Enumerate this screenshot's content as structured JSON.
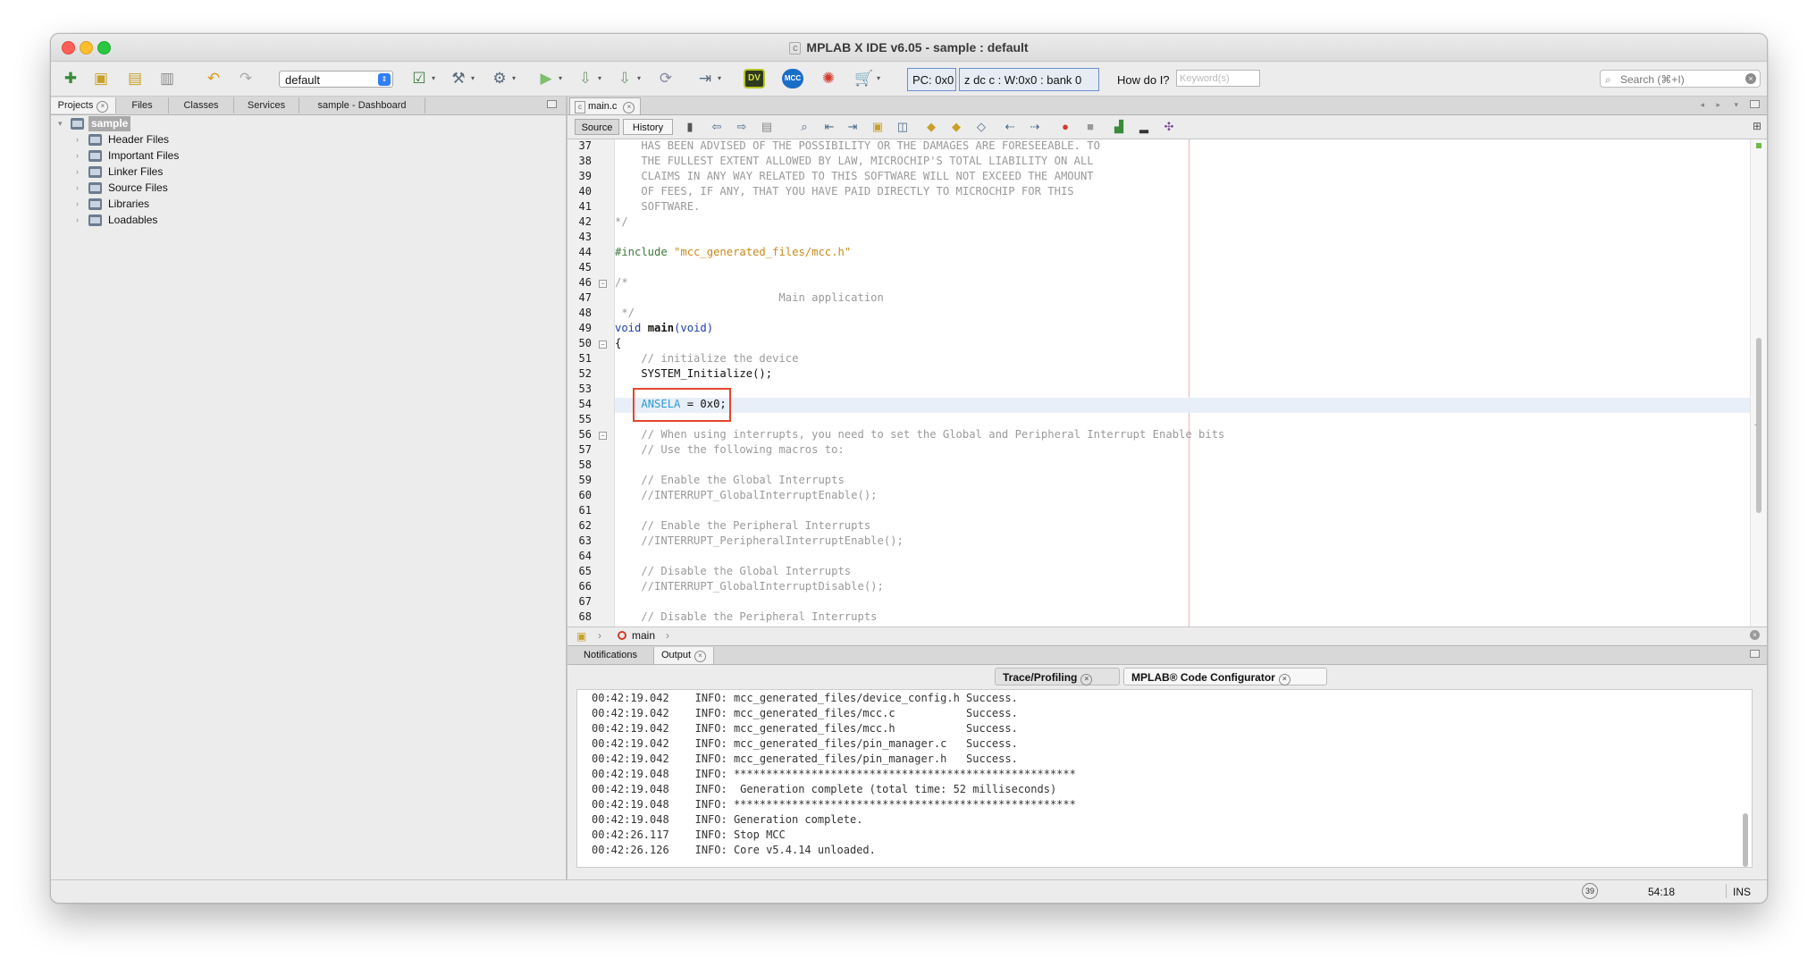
{
  "window": {
    "title": "MPLAB X IDE v6.05 - sample : default",
    "title_icon": "c"
  },
  "toolbar": {
    "configuration": "default",
    "pc_label": "PC: 0x0",
    "status_flags": "z dc c  : W:0x0 : bank 0",
    "how_do_i": "How do I?",
    "keyword_placeholder": "Keyword(s)",
    "search_placeholder": "Search (⌘+I)",
    "dv_badge": "DV",
    "mcc_badge": "MCC",
    "icons": [
      "new-file-icon",
      "new-project-icon",
      "open-project-icon",
      "close-project-icon",
      "undo-icon",
      "redo-icon",
      "project-properties-icon",
      "build-icon",
      "clean-build-icon",
      "run-icon",
      "debug-icon",
      "program-device-icon",
      "read-device-icon",
      "hold-reset-icon",
      "data-visualizer-icon",
      "mcc-icon",
      "ipe-icon",
      "cart-icon"
    ]
  },
  "projects_panel": {
    "tabs": [
      "Projects",
      "Files",
      "Classes",
      "Services",
      "sample - Dashboard"
    ],
    "active_tab": "Projects",
    "project_name": "sample",
    "items": [
      "Header Files",
      "Important Files",
      "Linker Files",
      "Source Files",
      "Libraries",
      "Loadables"
    ]
  },
  "editor": {
    "file_tab": "main.c",
    "source_button": "Source",
    "history_button": "History",
    "lines": [
      {
        "n": "37",
        "text": "    HAS BEEN ADVISED OF THE POSSIBILITY OR THE DAMAGES ARE FORESEEABLE. TO"
      },
      {
        "n": "38",
        "text": "    THE FULLEST EXTENT ALLOWED BY LAW, MICROCHIP'S TOTAL LIABILITY ON ALL"
      },
      {
        "n": "39",
        "text": "    CLAIMS IN ANY WAY RELATED TO THIS SOFTWARE WILL NOT EXCEED THE AMOUNT"
      },
      {
        "n": "40",
        "text": "    OF FEES, IF ANY, THAT YOU HAVE PAID DIRECTLY TO MICROCHIP FOR THIS"
      },
      {
        "n": "41",
        "text": "    SOFTWARE."
      },
      {
        "n": "42",
        "text": "*/"
      },
      {
        "n": "43",
        "text": ""
      },
      {
        "n": "44",
        "text": "#include \"mcc_generated_files/mcc.h\""
      },
      {
        "n": "45",
        "text": ""
      },
      {
        "n": "46",
        "text": "/*"
      },
      {
        "n": "47",
        "text": "                         Main application"
      },
      {
        "n": "48",
        "text": " */"
      },
      {
        "n": "49",
        "text": "void main(void)"
      },
      {
        "n": "50",
        "text": "{"
      },
      {
        "n": "51",
        "text": "    // initialize the device"
      },
      {
        "n": "52",
        "text": "    SYSTEM_Initialize();"
      },
      {
        "n": "53",
        "text": ""
      },
      {
        "n": "54",
        "text": "    ANSELA = 0x0;"
      },
      {
        "n": "55",
        "text": ""
      },
      {
        "n": "56",
        "text": "    // When using interrupts, you need to set the Global and Peripheral Interrupt Enable bits"
      },
      {
        "n": "57",
        "text": "    // Use the following macros to:"
      },
      {
        "n": "58",
        "text": ""
      },
      {
        "n": "59",
        "text": "    // Enable the Global Interrupts"
      },
      {
        "n": "60",
        "text": "    //INTERRUPT_GlobalInterruptEnable();"
      },
      {
        "n": "61",
        "text": ""
      },
      {
        "n": "62",
        "text": "    // Enable the Peripheral Interrupts"
      },
      {
        "n": "63",
        "text": "    //INTERRUPT_PeripheralInterruptEnable();"
      },
      {
        "n": "64",
        "text": ""
      },
      {
        "n": "65",
        "text": "    // Disable the Global Interrupts"
      },
      {
        "n": "66",
        "text": "    //INTERRUPT_GlobalInterruptDisable();"
      },
      {
        "n": "67",
        "text": ""
      },
      {
        "n": "68",
        "text": "    // Disable the Peripheral Interrupts"
      }
    ],
    "nav_function": "main"
  },
  "output_panel": {
    "tabs": [
      "Notifications",
      "Output"
    ],
    "active_tab": "Output",
    "subtabs": [
      "Trace/Profiling",
      "MPLAB® Code Configurator"
    ],
    "active_subtab": "MPLAB® Code Configurator",
    "lines": [
      "00:42:19.042    INFO: mcc_generated_files/device_config.h Success.",
      "00:42:19.042    INFO: mcc_generated_files/mcc.c           Success.",
      "00:42:19.042    INFO: mcc_generated_files/mcc.h           Success.",
      "00:42:19.042    INFO: mcc_generated_files/pin_manager.c   Success.",
      "00:42:19.042    INFO: mcc_generated_files/pin_manager.h   Success.",
      "00:42:19.048    INFO: *****************************************************",
      "00:42:19.048    INFO:  Generation complete (total time: 52 milliseconds)",
      "00:42:19.048    INFO: *****************************************************",
      "00:42:19.048    INFO: Generation complete.",
      "00:42:26.117    INFO: Stop MCC",
      "00:42:26.126    INFO: Core v5.4.14 unloaded."
    ]
  },
  "status_bar": {
    "notification_count": "39",
    "position": "54:18",
    "mode": "INS"
  }
}
